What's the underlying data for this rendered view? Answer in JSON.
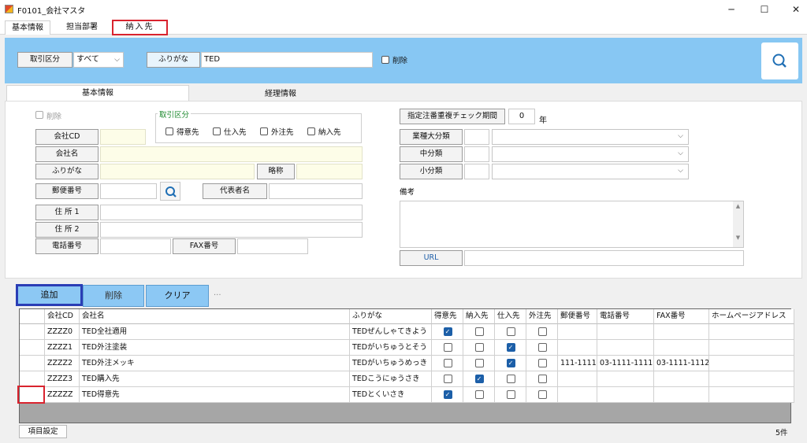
{
  "window": {
    "title": "F0101_会社マスタ",
    "min": "─",
    "max": "☐",
    "close": "✕"
  },
  "main_tabs": [
    "基本情報",
    "担当部署",
    "納入先"
  ],
  "search": {
    "kubun_label": "取引区分",
    "kubun_value": "すべて",
    "furigana_label": "ふりがな",
    "furigana_value": "TED",
    "delete_label": "削除"
  },
  "sub_tabs": [
    "基本情報",
    "経理情報"
  ],
  "form": {
    "delete_label": "削除",
    "torihiki_group": "取引区分",
    "torihiki_opts": [
      "得意先",
      "仕入先",
      "外注先",
      "納入先"
    ],
    "company_cd": "会社CD",
    "company_name": "会社名",
    "furigana": "ふりがな",
    "ryakusho": "略称",
    "postal": "郵便番号",
    "daihyo": "代表者名",
    "addr1": "住 所 1",
    "addr2": "住 所 2",
    "tel": "電話番号",
    "fax": "FAX番号",
    "period_label": "指定注番重複チェック期間",
    "period_value": "0",
    "period_unit": "年",
    "cat_large": "業種大分類",
    "cat_mid": "中分類",
    "cat_small": "小分類",
    "biko": "備考",
    "url": "URL"
  },
  "actions": {
    "add": "追加",
    "delete": "削除",
    "clear": "クリア",
    "more": "···"
  },
  "grid": {
    "headers": [
      "会社CD",
      "会社名",
      "ふりがな",
      "得意先",
      "納入先",
      "仕入先",
      "外注先",
      "郵便番号",
      "電話番号",
      "FAX番号",
      "ホームページアドレス"
    ],
    "rows": [
      {
        "cd": "ZZZZ0",
        "name": "TED全社適用",
        "furigana": "TEDぜんしゃてきよう",
        "tokui": true,
        "nonyu": false,
        "shiire": false,
        "gaichu": false,
        "zip": "",
        "tel": "",
        "fax": ""
      },
      {
        "cd": "ZZZZ1",
        "name": "TED外注塗装",
        "furigana": "TEDがいちゅうとそう",
        "tokui": false,
        "nonyu": false,
        "shiire": true,
        "gaichu": false,
        "zip": "",
        "tel": "",
        "fax": ""
      },
      {
        "cd": "ZZZZ2",
        "name": "TED外注メッキ",
        "furigana": "TEDがいちゅうめっき",
        "tokui": false,
        "nonyu": false,
        "shiire": true,
        "gaichu": false,
        "zip": "111-1111",
        "tel": "03-1111-1111",
        "fax": "03-1111-1112"
      },
      {
        "cd": "ZZZZ3",
        "name": "TED購入先",
        "furigana": "TEDこうにゅうさき",
        "tokui": false,
        "nonyu": true,
        "shiire": false,
        "gaichu": false,
        "zip": "",
        "tel": "",
        "fax": ""
      },
      {
        "cd": "ZZZZZ",
        "name": "TED得意先",
        "furigana": "TEDとくいさき",
        "tokui": true,
        "nonyu": false,
        "shiire": false,
        "gaichu": false,
        "zip": "",
        "tel": "",
        "fax": ""
      }
    ]
  },
  "footer": {
    "settings": "項目設定",
    "count": "5件"
  },
  "colors": {
    "accent": "#87c7f3",
    "highlight_red": "#d9232e",
    "highlight_blue": "#2a3db5",
    "check_blue": "#1c5fa8"
  }
}
